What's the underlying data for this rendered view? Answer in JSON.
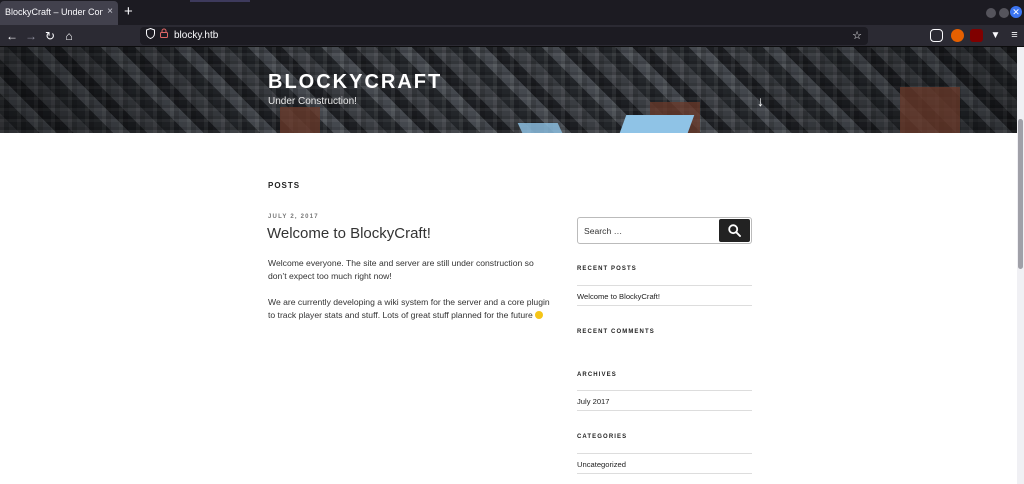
{
  "browser": {
    "tab_title": "BlockyCraft – Under Construction!",
    "tab_close": "×",
    "new_tab": "+",
    "url": "blocky.htb",
    "nav": {
      "back": "←",
      "forward": "→",
      "reload": "↻",
      "home": "⌂"
    },
    "icons": {
      "shield": "shield-icon",
      "lock": "lock-icon",
      "star": "☆"
    },
    "window_close": "✕",
    "menu": "≡"
  },
  "site": {
    "title": "BLOCKYCRAFT",
    "description": "Under Construction!",
    "scroll_arrow": "↓"
  },
  "main": {
    "posts_heading": "POSTS",
    "post": {
      "date": "JULY 2, 2017",
      "title": "Welcome to BlockyCraft!",
      "paragraph1": "Welcome everyone. The site and server are still under construction so don’t expect too much right now!",
      "paragraph2": "We are currently developing a wiki system for the server and a core plugin to track player stats and stuff. Lots of great stuff planned for the future"
    }
  },
  "sidebar": {
    "search_placeholder": "Search …",
    "recent_posts_title": "RECENT POSTS",
    "recent_posts": [
      "Welcome to BlockyCraft!"
    ],
    "recent_comments_title": "RECENT COMMENTS",
    "archives_title": "ARCHIVES",
    "archives": [
      "July 2017"
    ],
    "categories_title": "CATEGORIES",
    "categories": [
      "Uncategorized"
    ]
  },
  "colors": {
    "browser_tabbar": "#1c1b22",
    "browser_navbar": "#2b2a33",
    "search_button": "#222222",
    "accent_blue": "#3b74f1"
  }
}
